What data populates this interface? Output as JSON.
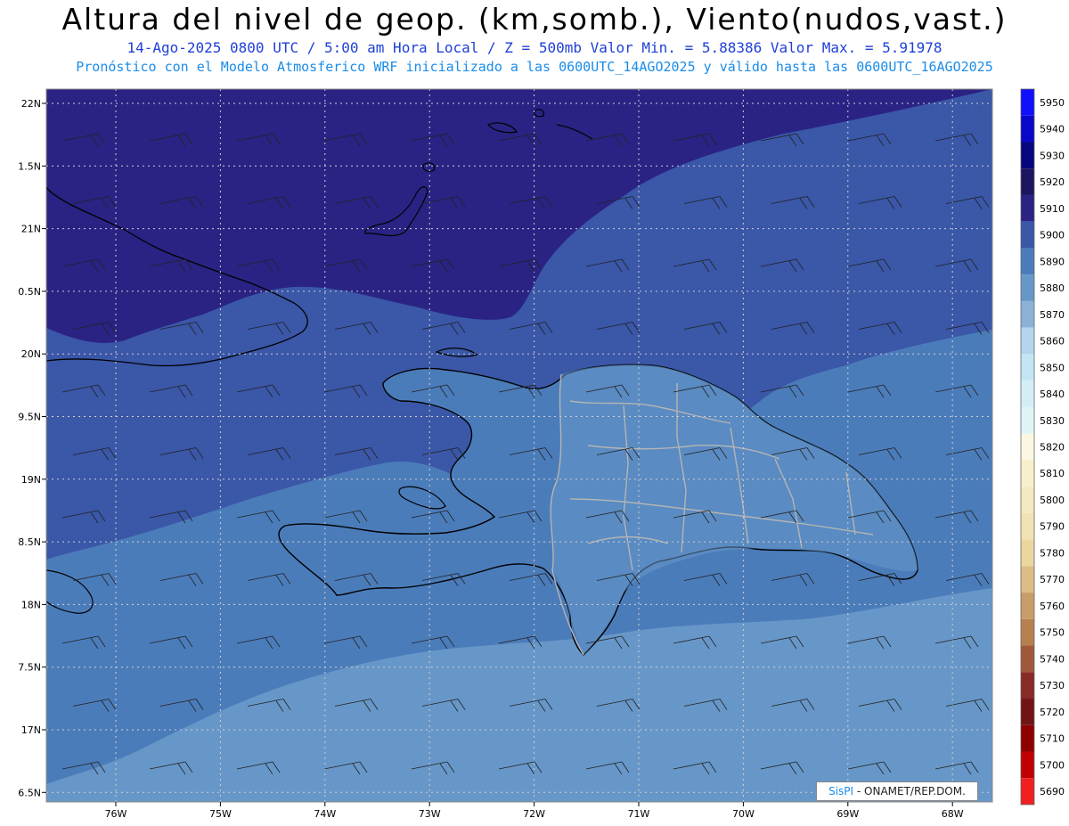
{
  "header": {
    "title": "Altura del nivel de geop. (km,somb.), Viento(nudos,vast.)",
    "line1": "14-Ago-2025  0800 UTC / 5:00 am Hora Local / Z = 500mb    Valor Min. = 5.88386  Valor Max. = 5.91978",
    "line2": "Pronóstico con el Modelo Atmosferico WRF inicializado a las 0600UTC_14AGO2025 y válido hasta las  0600UTC_16AGO2025"
  },
  "map": {
    "lat_labels": [
      "22N",
      "1.5N",
      "21N",
      "0.5N",
      "20N",
      "9.5N",
      "19N",
      "8.5N",
      "18N",
      "7.5N",
      "17N",
      "6.5N"
    ],
    "lon_labels": [
      "76W",
      "75W",
      "74W",
      "73W",
      "72W",
      "71W",
      "70W",
      "69W",
      "68W"
    ],
    "colors": {
      "z5920": "#2a2384",
      "z5910": "#3a57a8",
      "z5900": "#4b7cba",
      "z5890": "#6797c8",
      "z5880": "#8ab2d6",
      "coast": "#000000",
      "borders": "#b4b4b4",
      "grid": "#cfcfcf"
    }
  },
  "colorbar": {
    "levels": [
      "5950",
      "5940",
      "5930",
      "5920",
      "5910",
      "5900",
      "5890",
      "5880",
      "5870",
      "5860",
      "5850",
      "5840",
      "5830",
      "5820",
      "5810",
      "5800",
      "5790",
      "5780",
      "5770",
      "5760",
      "5750",
      "5740",
      "5730",
      "5720",
      "5710",
      "5700",
      "5690"
    ],
    "colors": [
      "#1010ff",
      "#0a08c8",
      "#08067e",
      "#1c1660",
      "#2a2384",
      "#3a57a8",
      "#4b7cba",
      "#6797c8",
      "#8ab2d6",
      "#b3d4ec",
      "#c4e6f4",
      "#d3eef7",
      "#e0f4f8",
      "#fbf7e2",
      "#f8f0cc",
      "#f5e9c0",
      "#f2e2b3",
      "#ecd6a0",
      "#dcbd85",
      "#c99d68",
      "#b7804f",
      "#a0583a",
      "#882a28",
      "#701414",
      "#8e0000",
      "#c00000",
      "#f02020"
    ]
  },
  "credit": {
    "brand": "SisPI",
    "text": " - ONAMET/REP.DOM."
  }
}
